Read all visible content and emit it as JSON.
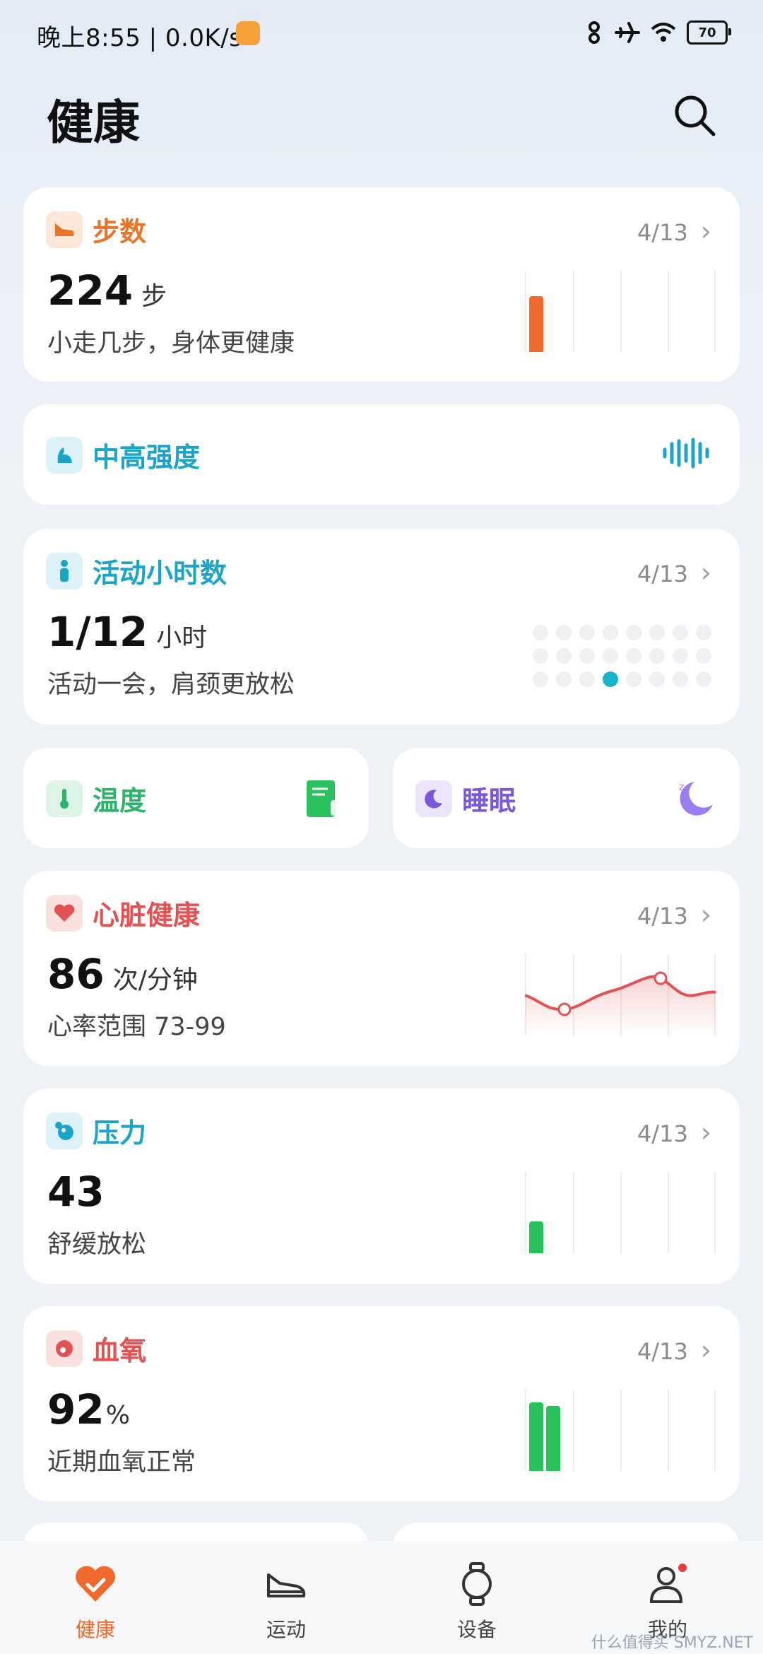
{
  "status_bar": {
    "time": "晚上8:55 | 0.0K/s",
    "battery": "70",
    "icons": [
      "link-icon",
      "airplane-icon",
      "wifi-icon",
      "battery-icon"
    ]
  },
  "header": {
    "title": "健康"
  },
  "cards": {
    "steps": {
      "title": "步数",
      "date": "4/13",
      "value": "224",
      "unit": "步",
      "subtitle": "小走几步，身体更健康",
      "color": "#e8742a",
      "bar_level": 0.75
    },
    "intensity": {
      "title": "中高强度",
      "color": "#1aa4c7"
    },
    "activity": {
      "title": "活动小时数",
      "date": "4/13",
      "value": "1/12",
      "unit": "小时",
      "subtitle": "活动一会，肩颈更放松",
      "color": "#1aa4c7",
      "active_hours": 1
    },
    "temperature": {
      "title": "温度",
      "color": "#2bb56a"
    },
    "sleep": {
      "title": "睡眠",
      "color": "#7b57d9"
    },
    "heart": {
      "title": "心脏健康",
      "date": "4/13",
      "value": "86",
      "unit": "次/分钟",
      "subtitle": "心率范围 73-99",
      "color": "#e35252"
    },
    "stress": {
      "title": "压力",
      "date": "4/13",
      "value": "43",
      "subtitle": "舒缓放松",
      "color": "#1aa4c7",
      "bar_level": 0.43
    },
    "spo2": {
      "title": "血氧",
      "date": "4/13",
      "value": "92",
      "unit": "%",
      "subtitle": "近期血氧正常",
      "color": "#e35252",
      "bar_levels": [
        0.92,
        0.88
      ]
    }
  },
  "nav": {
    "items": [
      {
        "label": "健康",
        "icon": "heart-check-icon",
        "active": true
      },
      {
        "label": "运动",
        "icon": "shoe-icon"
      },
      {
        "label": "设备",
        "icon": "watch-icon"
      },
      {
        "label": "我的",
        "icon": "person-icon"
      }
    ]
  },
  "watermark": "什么值得买 SMYZ.NET"
}
